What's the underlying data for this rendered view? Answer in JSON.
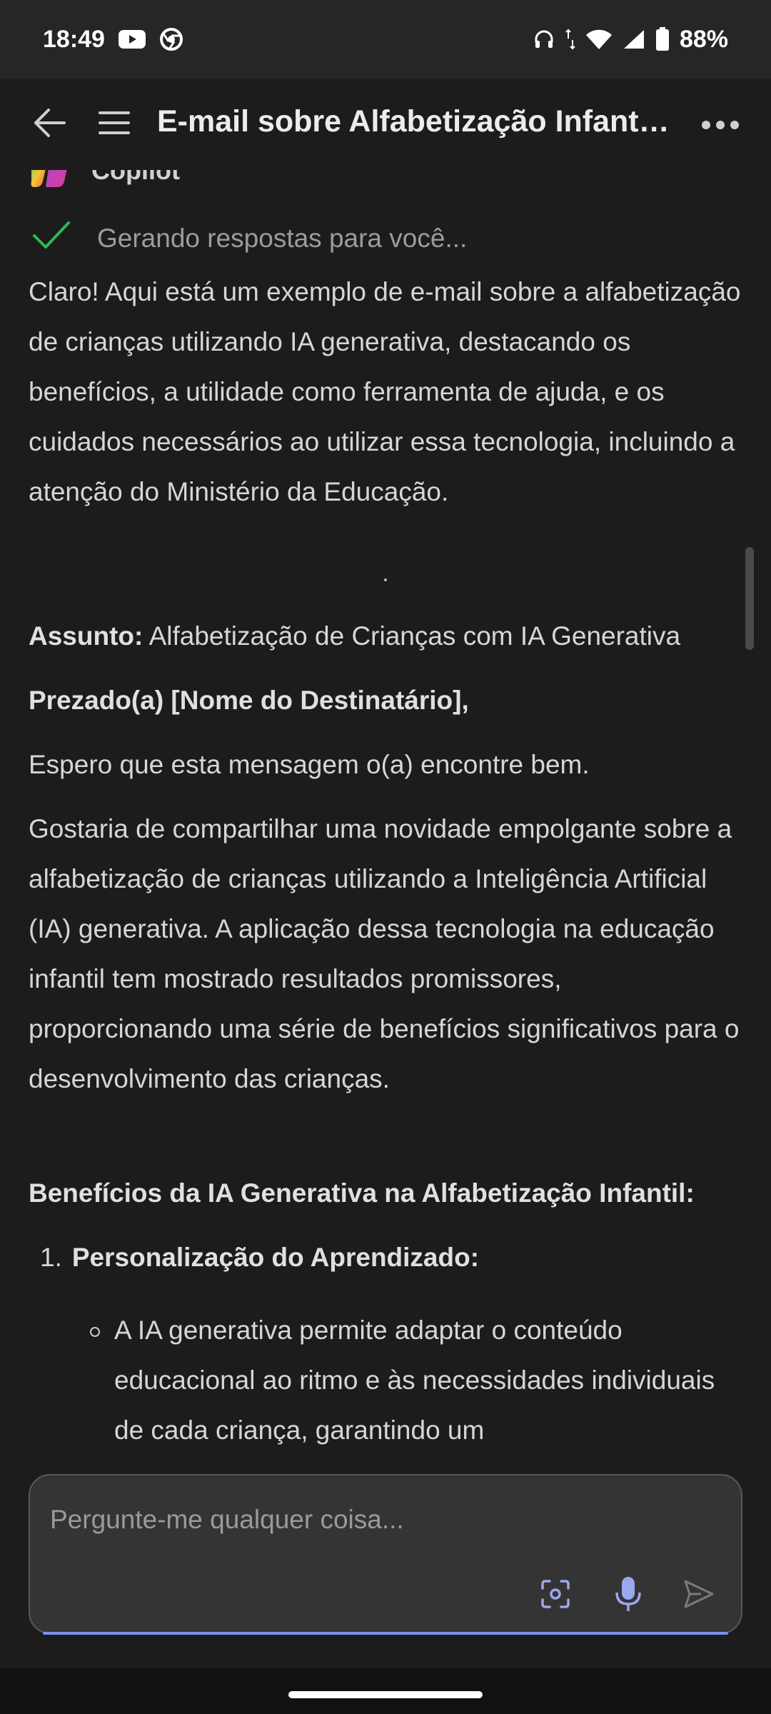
{
  "status_bar": {
    "time": "18:49",
    "battery": "88%",
    "icons": [
      "youtube-icon",
      "chrome-icon",
      "headphones-icon",
      "wifi-icon",
      "signal-icon",
      "battery-icon"
    ]
  },
  "app_bar": {
    "title": "E-mail sobre Alfabetização Infanti..."
  },
  "assistant": {
    "name": "Copilot",
    "progress_text": "Gerando respostas para você..."
  },
  "message": {
    "intro": "Claro! Aqui está um exemplo de e-mail sobre a alfabetização de crianças utilizando IA generativa, destacando os benefícios, a utilidade como ferramenta de ajuda, e os cuidados necessários ao utilizar essa tecnologia, incluindo a atenção do Ministério da Educação.",
    "subject_label": "Assunto:",
    "subject_value": "Alfabetização de Crianças com IA Generativa",
    "greeting": "Prezado(a) [Nome do Destinatário],",
    "opening": "Espero que esta mensagem o(a) encontre bem.",
    "paragraph": "Gostaria de compartilhar uma novidade empolgante sobre a alfabetização de crianças utilizando a Inteligência Artificial (IA) generativa. A aplicação dessa tecnologia na educação infantil tem mostrado resultados promissores, proporcionando uma série de benefícios significativos para o desenvolvimento das crianças.",
    "benefits_heading": "Benefícios da IA Generativa na Alfabetização Infantil:",
    "list": [
      {
        "number": "1.",
        "title": "Personalização do Aprendizado:",
        "bullet": "A IA generativa permite adaptar o conteúdo educacional ao ritmo e às necessidades individuais de cada criança, garantindo um"
      }
    ]
  },
  "composer": {
    "placeholder": "Pergunte-me qualquer coisa...",
    "accent_color": "#7d8ff2"
  }
}
